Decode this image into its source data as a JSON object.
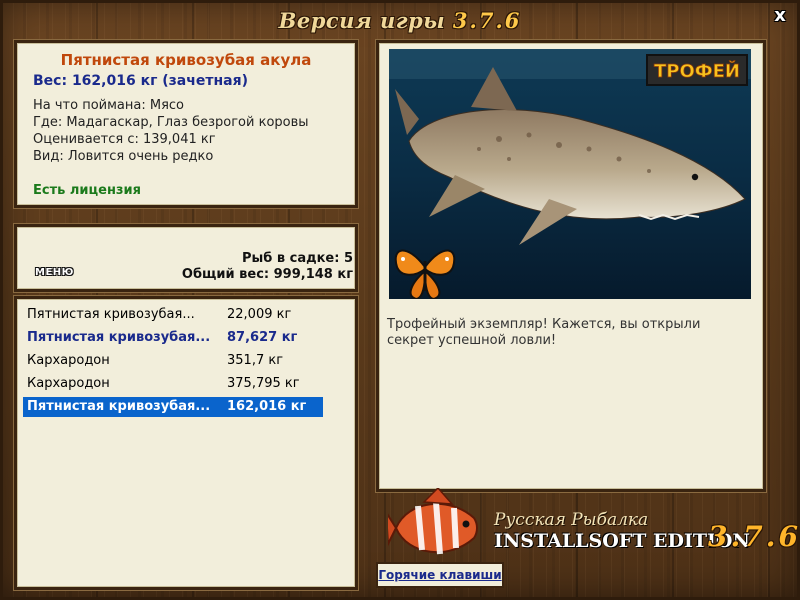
{
  "window": {
    "title_text": "Версия игры",
    "title_version": "3.7.6",
    "close_label": "x"
  },
  "fish_info": {
    "name": "Пятнистая кривозубая акула",
    "weight": "Вес: 162,016 кг (зачетная)",
    "caught_on": "На что поймана: Мясо",
    "location": "Где: Мадагаскар, Глаз безрогой коровы",
    "valued_from": "Оценивается с: 139,041 кг",
    "rarity": "Вид: Ловится очень редко",
    "license": "Есть лицензия"
  },
  "cage": {
    "menu_label": "МЕНЮ",
    "fish_count": "Рыб в садке: 5",
    "total_weight": "Общий вес: 999,148 кг"
  },
  "catch_list": [
    {
      "name": "Пятнистая кривозубая...",
      "weight": "22,009 кг",
      "style": "normal"
    },
    {
      "name": "Пятнистая кривозубая...",
      "weight": "87,627 кг",
      "style": "bold"
    },
    {
      "name": "Кархародон",
      "weight": "351,7 кг",
      "style": "normal"
    },
    {
      "name": "Кархародон",
      "weight": "375,795 кг",
      "style": "normal"
    },
    {
      "name": "Пятнистая кривозубая...",
      "weight": "162,016 кг",
      "style": "selected"
    }
  ],
  "picture": {
    "trophy_badge": "ТРОФЕЙ",
    "description": "Трофейный экземпляр! Кажется, вы открыли секрет успешной ловли!"
  },
  "branding": {
    "game_name": "Русская Рыбалка",
    "edition": "INSTALLSOFT EDITION",
    "version": "3.7.6"
  },
  "hotkeys_label": "Горячие клавиши",
  "colors": {
    "fish_name": "#c0480c",
    "weight_text": "#1a2a8c",
    "license_text": "#1b7a1b",
    "selection": "#0a64cc",
    "panel_bg": "#f2eedb"
  }
}
